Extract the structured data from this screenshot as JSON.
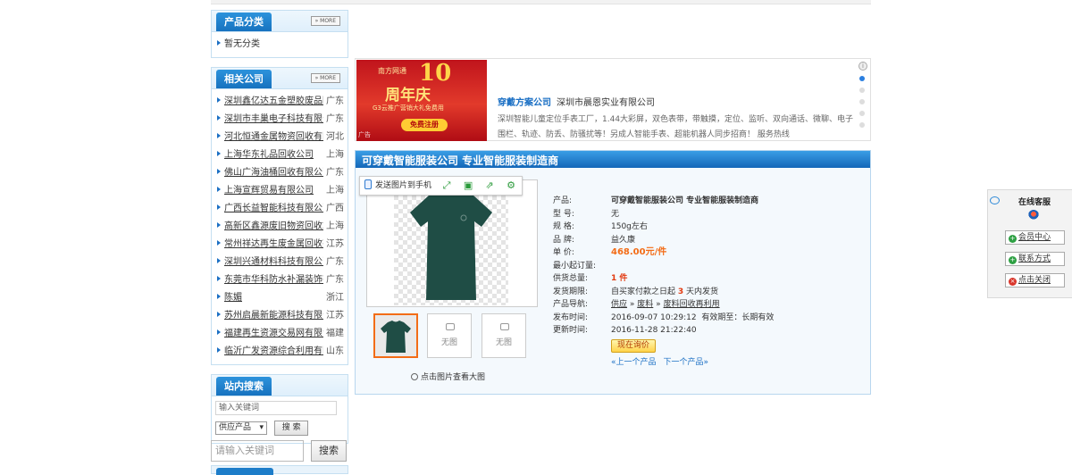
{
  "category_box": {
    "title": "产品分类",
    "more": "» MORE",
    "items": [
      "暂无分类"
    ]
  },
  "related_box": {
    "title": "相关公司",
    "more": "» MORE",
    "companies": [
      {
        "name": "深圳鑫亿达五金塑胶废品回收站",
        "province": "广东"
      },
      {
        "name": "深圳市丰巢电子科技有限公司",
        "province": "广东"
      },
      {
        "name": "河北恒通金属物资回收有限公司",
        "province": "河北"
      },
      {
        "name": "上海华东礼品回收公司",
        "province": "上海"
      },
      {
        "name": "佛山广海油桶回收有限公司",
        "province": "广东"
      },
      {
        "name": "上海宣辉贸易有限公司",
        "province": "上海"
      },
      {
        "name": "广西长益智能科技有限公司",
        "province": "广西"
      },
      {
        "name": "高新区鑫源废旧物资回收站",
        "province": "上海"
      },
      {
        "name": "常州祥达再生废金属回收有限公司",
        "province": "江苏"
      },
      {
        "name": "深圳兴通材料科技有限公司",
        "province": "广东"
      },
      {
        "name": "东莞市华科防水补漏装饰有限公司",
        "province": "广东"
      },
      {
        "name": "陈媚",
        "province": "浙江"
      },
      {
        "name": "苏州启晨新能源科技有限公司",
        "province": "江苏"
      },
      {
        "name": "福建再生资源交易网有限责任公司",
        "province": "福建"
      },
      {
        "name": "临沂广发资源综合利用有限公司",
        "province": "山东"
      }
    ]
  },
  "site_search": {
    "title": "站内搜索",
    "input_value": "输入关键词",
    "type_selected": "供应产品",
    "button": "搜 索"
  },
  "bottom_search": {
    "placeholder": "请输入关键词",
    "button": "搜索"
  },
  "ad": {
    "brand": "南方网通",
    "big": "10",
    "celebration": "周年庆",
    "sub": "G3云推广营销大礼免费用",
    "register": "免费注册",
    "tag": "广告",
    "title_link": "穿戴方案公司",
    "company": "深圳市晨恩实业有限公司",
    "text": "深圳智能儿童定位手表工厂，1.44大彩屏，双色表带，带触摸，定位、监听、双向通话、微聊、电子围栏、轨迹、防丢、防骚扰等！另成人智能手表、超能机器人同步招商！ 服务热线",
    "info": "i"
  },
  "product": {
    "panel_title": "可穿戴智能服装公司 专业智能服装制造商",
    "toolbar": {
      "send": "发送图片到手机"
    },
    "no_image": "无图",
    "zoom": "点击图片查看大图",
    "fields": {
      "name_k": "产品:",
      "name_v": "可穿戴智能服装公司 专业智能服装制造商",
      "model_k": "型 号:",
      "model_v": "无",
      "spec_k": "规 格:",
      "spec_v": "150g左右",
      "brand_k": "品 牌:",
      "brand_v": "益久康",
      "price_k": "单 价:",
      "price_v": "468.00元/件",
      "moq_k": "最小起订量:",
      "moq_v": "",
      "supply_k": "供货总量:",
      "supply_v": "1 件",
      "ship_k": "发货期限:",
      "ship_pre": "自买家付款之日起",
      "ship_days": "3",
      "ship_post": "天内发货",
      "nav_k": "产品导航:",
      "nav_1": "供应",
      "nav_sep": "»",
      "nav_2": "废料",
      "nav_3": "废料回收再利用",
      "pub_k": "发布时间:",
      "pub_v": "2016-09-07 10:29:12",
      "valid": "有效期至：长期有效",
      "upd_k": "更新时间:",
      "upd_v": "2016-11-28 21:22:40"
    },
    "quote_btn": "现在询价",
    "prev": "«上一个产品",
    "next": "下一个产品»"
  },
  "service": {
    "title": "在线客服",
    "member": "会员中心",
    "contact": "联系方式",
    "close": "点击关闭"
  },
  "colors": {
    "accent_blue": "#1a6fc4",
    "orange": "#f36c16",
    "header_blue": "#1672bf"
  }
}
